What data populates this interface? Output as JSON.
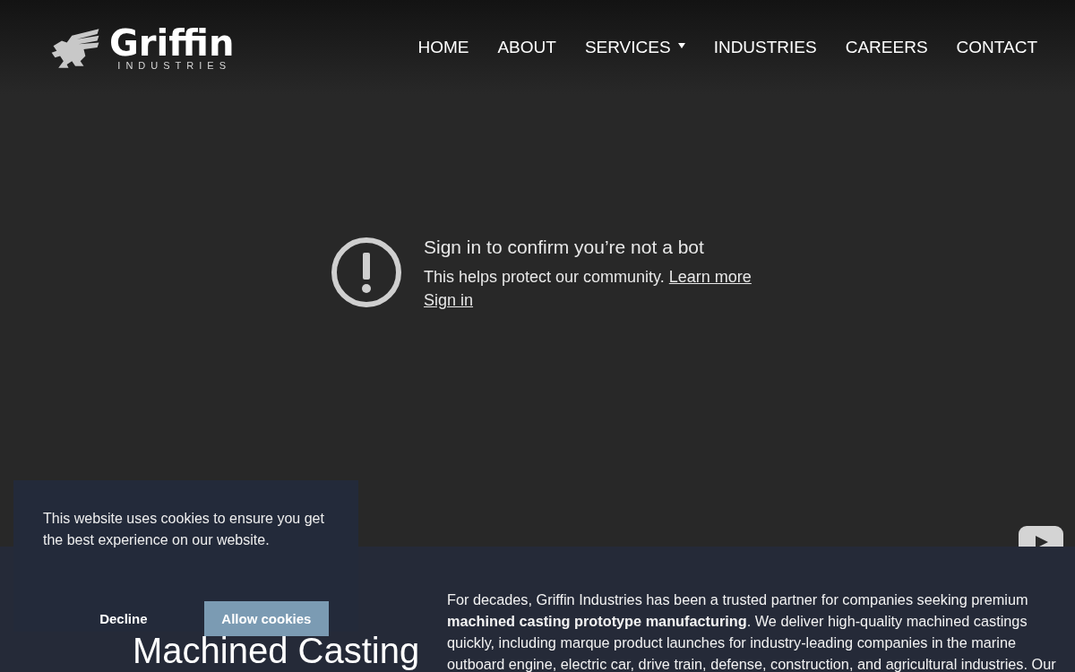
{
  "header": {
    "logo": {
      "name": "Griffin",
      "tagline": "INDUSTRIES"
    },
    "nav": [
      {
        "label": "HOME",
        "dropdown": false
      },
      {
        "label": "ABOUT",
        "dropdown": false
      },
      {
        "label": "SERVICES",
        "dropdown": true
      },
      {
        "label": "INDUSTRIES",
        "dropdown": false
      },
      {
        "label": "CAREERS",
        "dropdown": false
      },
      {
        "label": "CONTACT",
        "dropdown": false
      }
    ]
  },
  "video": {
    "title": "Sign in to confirm you’re not a bot",
    "message": "This helps protect our community.",
    "learn_more": "Learn more",
    "sign_in": "Sign in"
  },
  "section": {
    "heading": "Machined Casting",
    "paragraph": "For decades, Griffin Industries has been a trusted partner for companies seeking premium **machined casting prototype manufacturing**. We deliver high-quality machined castings quickly, including marque product launches for industry-leading companies in the marine outboard engine, electric car, drive train, defense, construction, and agricultural industries. Our"
  },
  "cookie_banner": {
    "message": "This website uses cookies to ensure you get the best experience on our website.",
    "buttons": [
      {
        "label": "Decline",
        "kind": "text"
      },
      {
        "label": "Allow cookies",
        "kind": "filled"
      }
    ]
  }
}
